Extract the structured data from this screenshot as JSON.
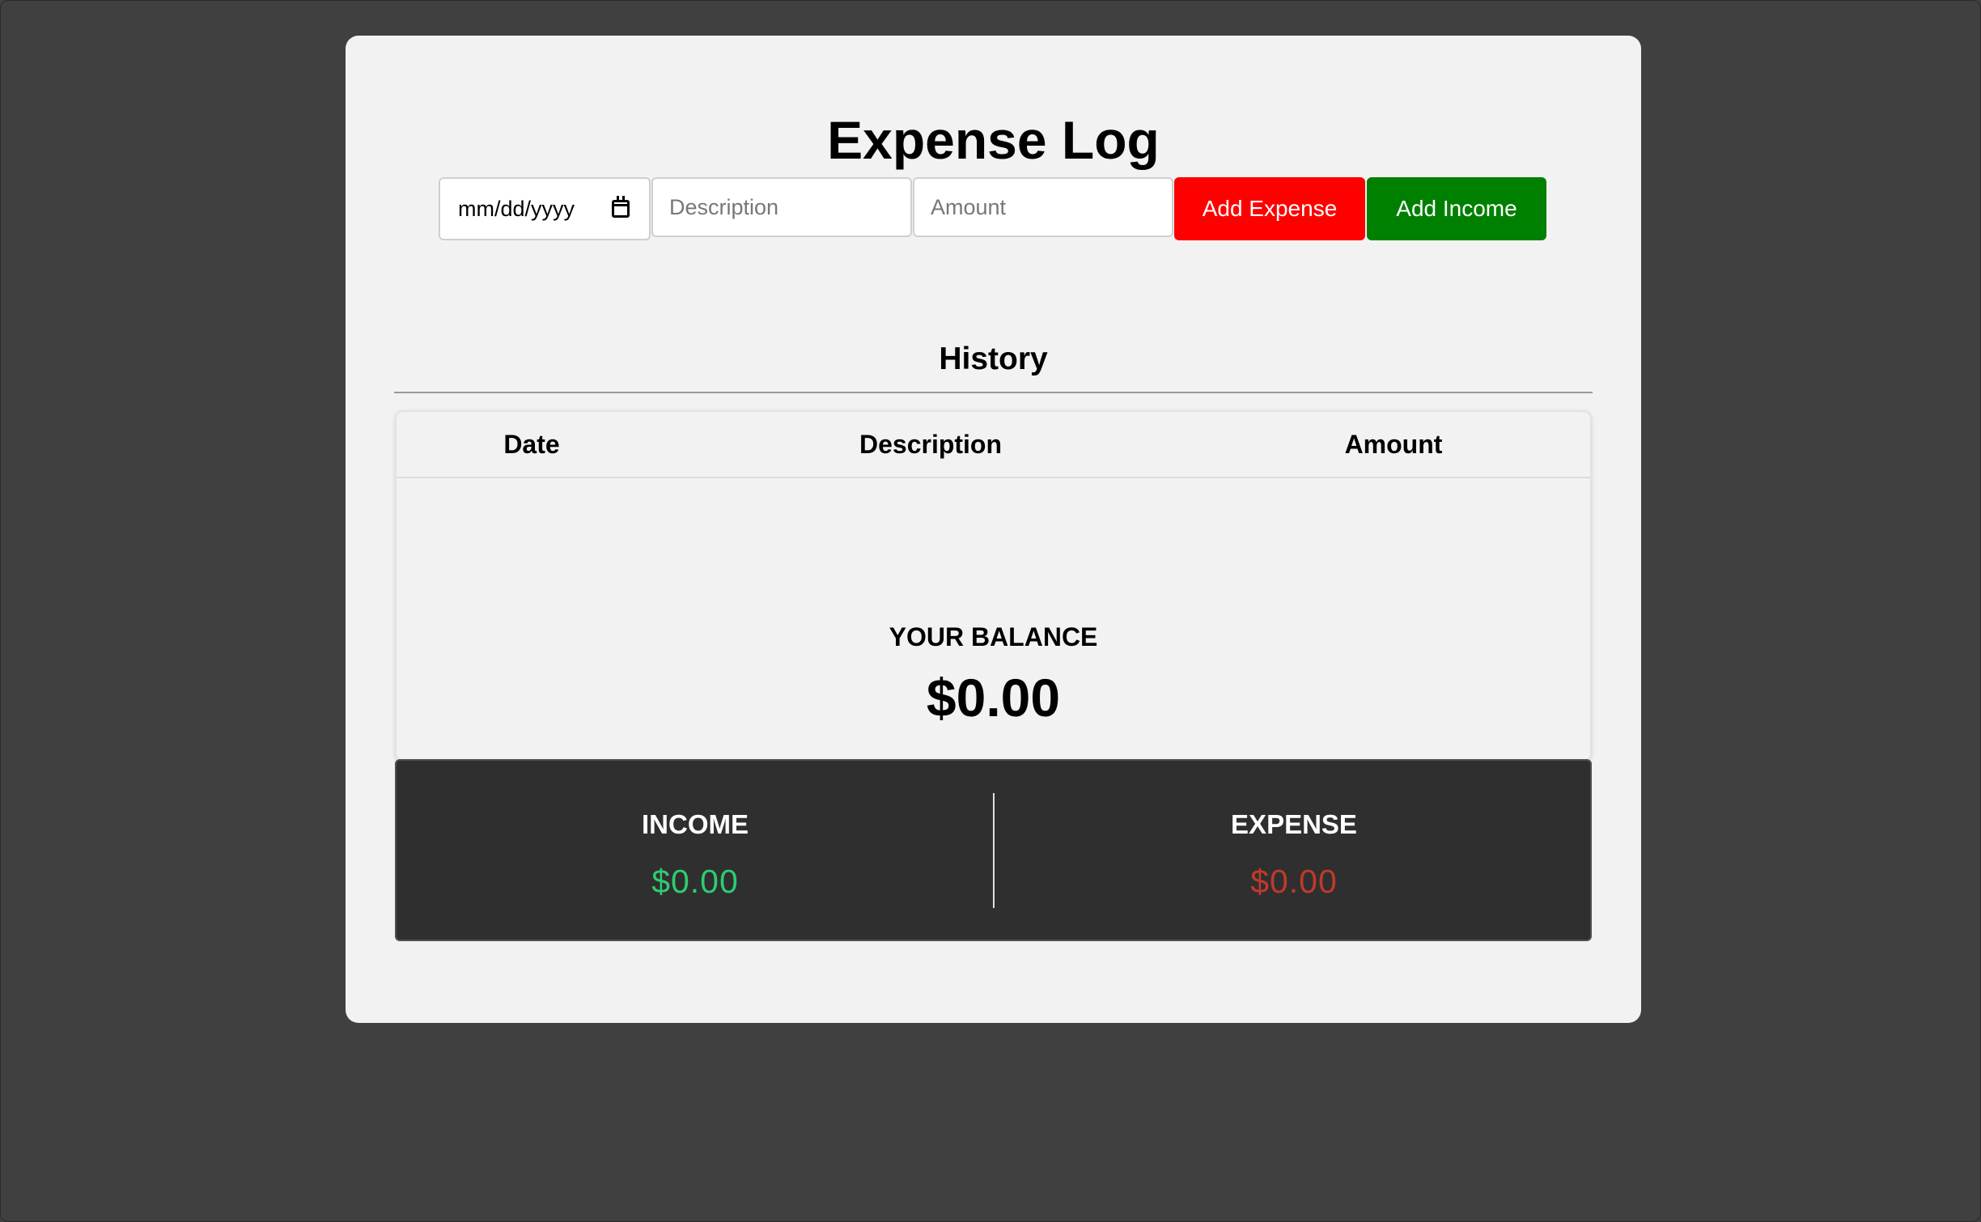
{
  "app": {
    "title": "Expense Log"
  },
  "form": {
    "date_placeholder": "mm/dd/yyyy",
    "description_placeholder": "Description",
    "amount_placeholder": "Amount",
    "add_expense_label": "Add Expense",
    "add_income_label": "Add Income"
  },
  "history": {
    "title": "History",
    "columns": [
      "Date",
      "Description",
      "Amount"
    ],
    "rows": []
  },
  "balance": {
    "label": "YOUR BALANCE",
    "value": "$0.00"
  },
  "summary": {
    "income_label": "INCOME",
    "income_value": "$0.00",
    "expense_label": "EXPENSE",
    "expense_value": "$0.00"
  },
  "colors": {
    "page_background": "#404040",
    "card_background": "#f2f2f2",
    "add_expense_button": "#ff0000",
    "add_income_button": "#008000",
    "income_value": "#2ecc71",
    "expense_value": "#c0392b",
    "summary_background": "#2f2f2f"
  },
  "icons": {
    "date_picker": "calendar-icon"
  }
}
